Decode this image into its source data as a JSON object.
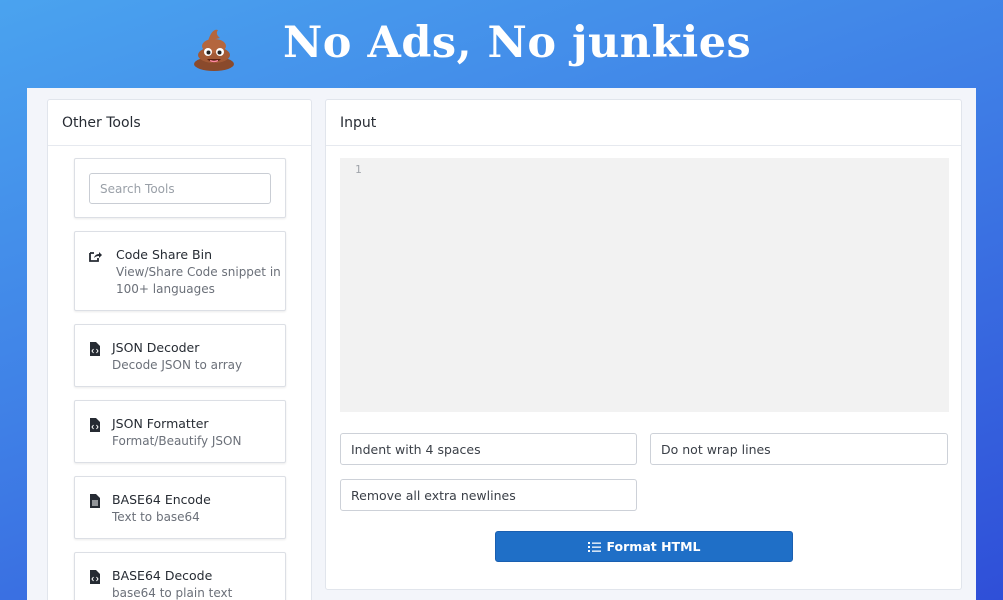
{
  "banner": {
    "emoji_icon": "poop-emoji-icon",
    "title": "No Ads, No junkies"
  },
  "sidebar": {
    "header": "Other Tools",
    "search_placeholder": "Search Tools",
    "tools": [
      {
        "icon": "share-icon",
        "title": "Code Share Bin",
        "description": "View/Share Code snippet in 100+ languages"
      },
      {
        "icon": "file-code-icon",
        "title": "JSON Decoder",
        "description": "Decode JSON to array"
      },
      {
        "icon": "file-code-icon",
        "title": "JSON Formatter",
        "description": "Format/Beautify JSON"
      },
      {
        "icon": "file-text-icon",
        "title": "BASE64 Encode",
        "description": "Text to base64"
      },
      {
        "icon": "file-code-icon",
        "title": "BASE64 Decode",
        "description": "base64 to plain text"
      }
    ]
  },
  "main": {
    "header": "Input",
    "editor": {
      "line_number": "1",
      "value": ""
    },
    "options": {
      "indent": "Indent with 4 spaces",
      "wrap": "Do not wrap lines",
      "newlines": "Remove all extra newlines"
    },
    "format_button": {
      "icon": "list-icon",
      "label": "Format HTML"
    }
  },
  "colors": {
    "accent": "#1f6fc7",
    "bg_top": "#4aa3ef",
    "bg_bottom": "#2f4fd8"
  }
}
